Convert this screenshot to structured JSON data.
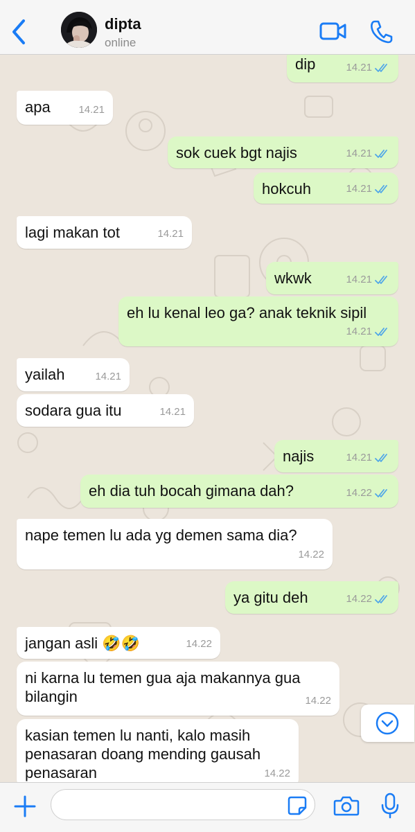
{
  "header": {
    "back_icon": "chevron-left-icon",
    "contact_name": "dipta",
    "contact_status": "online",
    "video_icon": "video-camera-icon",
    "call_icon": "phone-icon",
    "accent_color": "#1a7cf5"
  },
  "messages": [
    {
      "direction": "outgoing",
      "text": "dip",
      "time": "14.21",
      "status": "read"
    },
    {
      "direction": "incoming",
      "text": "apa",
      "time": "14.21"
    },
    {
      "direction": "outgoing",
      "text": "sok cuek bgt najis",
      "time": "14.21",
      "status": "read"
    },
    {
      "direction": "outgoing",
      "text": "hokcuh",
      "time": "14.21",
      "status": "read"
    },
    {
      "direction": "incoming",
      "text": "lagi makan tot",
      "time": "14.21"
    },
    {
      "direction": "outgoing",
      "text": "wkwk",
      "time": "14.21",
      "status": "read"
    },
    {
      "direction": "outgoing",
      "text": "eh lu kenal leo ga? anak teknik sipil",
      "time": "14.21",
      "status": "read"
    },
    {
      "direction": "incoming",
      "text": "yailah",
      "time": "14.21"
    },
    {
      "direction": "incoming",
      "text": "sodara gua itu",
      "time": "14.21"
    },
    {
      "direction": "outgoing",
      "text": "najis",
      "time": "14.21",
      "status": "read"
    },
    {
      "direction": "outgoing",
      "text": "eh dia tuh bocah gimana dah?",
      "time": "14.22",
      "status": "read"
    },
    {
      "direction": "incoming",
      "text": "nape temen lu ada yg demen sama dia?",
      "time": "14.22"
    },
    {
      "direction": "outgoing",
      "text": "ya gitu deh",
      "time": "14.22",
      "status": "read"
    },
    {
      "direction": "incoming",
      "text": "jangan asli 🤣🤣",
      "time": "14.22"
    },
    {
      "direction": "incoming",
      "text": "ni karna lu temen gua aja makannya gua bilangin",
      "time": "14.22"
    },
    {
      "direction": "incoming",
      "text": "kasian temen lu nanti, kalo masih penasaran doang mending gausah penasaran",
      "time": "14.22"
    }
  ],
  "colors": {
    "incoming_bubble": "#ffffff",
    "outgoing_bubble": "#dcf8c6",
    "read_tick": "#4fa6e8",
    "chat_background": "#ece5dc"
  },
  "scroll_down_icon": "chevron-down-circle-icon",
  "input_bar": {
    "plus_icon": "plus-icon",
    "message_value": "",
    "sticker_icon": "sticker-icon",
    "camera_icon": "camera-icon",
    "mic_icon": "microphone-icon"
  }
}
